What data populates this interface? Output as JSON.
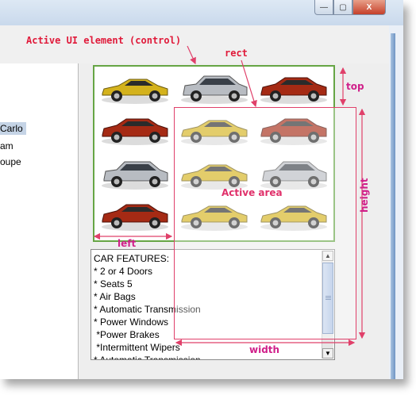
{
  "window": {
    "close_glyph": "X",
    "min_glyph": "—",
    "max_glyph": "▢"
  },
  "list": {
    "items": [
      {
        "label": "Carlo",
        "selected": true
      },
      {
        "label": "am",
        "selected": false
      },
      {
        "label": "oupe",
        "selected": false
      }
    ]
  },
  "cars": [
    {
      "color": "#d4b21c",
      "kind": "coupe"
    },
    {
      "color": "#b8bcc2",
      "kind": "suv"
    },
    {
      "color": "#a52a14",
      "kind": "sedan"
    },
    {
      "color": "#a52a14",
      "kind": "sedan"
    },
    {
      "color": "#d4b21c",
      "kind": "coupe"
    },
    {
      "color": "#a52a14",
      "kind": "sedan"
    },
    {
      "color": "#b8bcc2",
      "kind": "suv"
    },
    {
      "color": "#d4b21c",
      "kind": "coupe"
    },
    {
      "color": "#b8bcc2",
      "kind": "suv"
    },
    {
      "color": "#a52a14",
      "kind": "sedan"
    },
    {
      "color": "#d4b21c",
      "kind": "coupe"
    },
    {
      "color": "#d4b21c",
      "kind": "coupe"
    }
  ],
  "features": {
    "lines": [
      "CAR FEATURES:",
      "* 2 or 4 Doors",
      "* Seats 5",
      "* Air Bags",
      "* Automatic Transmission",
      "* Power Windows",
      " *Power Brakes",
      " *Intermittent Wipers",
      "* Automatic Transmission"
    ]
  },
  "annotations": {
    "active_ui": "Active UI element (control)",
    "rect": "rect",
    "top": "top",
    "left": "left",
    "height": "height",
    "width": "width",
    "active_area": "Active area"
  },
  "colors": {
    "accent": "#e01a3a",
    "panel_border": "#66a545"
  }
}
